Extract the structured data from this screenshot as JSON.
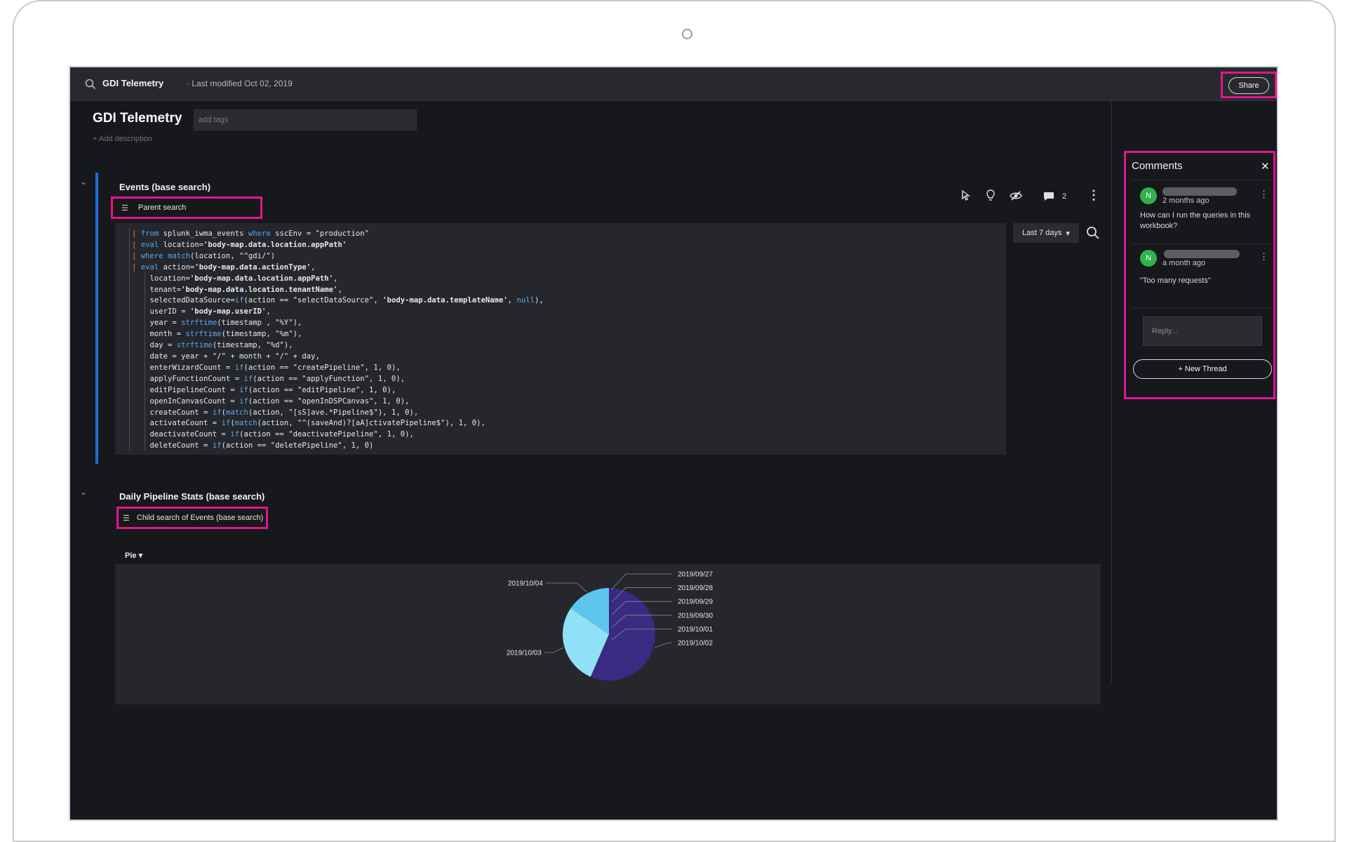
{
  "topbar": {
    "title": "GDI Telemetry",
    "modified": "· Last modified Oct 02, 2019",
    "share_label": "Share"
  },
  "header": {
    "title": "GDI Telemetry",
    "tags_placeholder": "add tags",
    "add_description": "+ Add description"
  },
  "events_section": {
    "title": "Events (base search)",
    "chip_label": "Parent search",
    "comment_count": "2",
    "time_range": "Last 7 days",
    "code_lines": [
      "| from splunk_iwma_events where sscEnv = \"production\"",
      "| eval location='body-map.data.location.appPath'",
      "| where match(location, \"^gdi/\")",
      "| eval action='body-map.data.actionType',",
      "    location='body-map.data.location.appPath',",
      "    tenant='body-map.data.location.tenantName',",
      "    selectedDataSource=if(action == \"selectDataSource\", 'body-map.data.templateName', null),",
      "    userID = 'body-map.userID',",
      "    year = strftime(timestamp , \"%Y\"),",
      "    month = strftime(timestamp, \"%m\"),",
      "    day = strftime(timestamp, \"%d\"),",
      "    date = year + \"/\" + month + \"/\" + day,",
      "    enterWizardCount = if(action == \"createPipeline\", 1, 0),",
      "    applyFunctionCount = if(action == \"applyFunction\", 1, 0),",
      "    editPipelineCount = if(action == \"editPipeline\", 1, 0),",
      "    openInCanvasCount = if(action == \"openInDSPCanvas\", 1, 0),",
      "    createCount = if(match(action, \"[sS]ave.*Pipeline$\"), 1, 0),",
      "    activateCount = if(match(action, \"^(saveAnd)?[aA]ctivatePipeline$\"), 1, 0),",
      "    deactivateCount = if(action == \"deactivatePipeline\", 1, 0),",
      "    deleteCount = if(action == \"deletePipeline\", 1, 0)"
    ]
  },
  "stats_section": {
    "title": "Daily Pipeline Stats (base search)",
    "chip_label": "Child search of Events (base search)",
    "viz_type": "Pie"
  },
  "chart_data": {
    "type": "pie",
    "categories": [
      "2019/09/27",
      "2019/09/28",
      "2019/09/29",
      "2019/09/30",
      "2019/10/01",
      "2019/10/02",
      "2019/10/03",
      "2019/10/04"
    ],
    "values": [
      0.5,
      0.5,
      0.5,
      0.5,
      0.5,
      54,
      28,
      15.5
    ],
    "colors": [
      "#3a2a80",
      "#3a2a80",
      "#3a2a80",
      "#3a2a80",
      "#3a2a80",
      "#3b2a82",
      "#8fe1f6",
      "#5cc6ee"
    ],
    "title": ""
  },
  "comments": {
    "title": "Comments",
    "items": [
      {
        "avatar": "N",
        "time": "2 months ago",
        "body": "How can I run the queries in this workbook?"
      },
      {
        "avatar": "N",
        "time": "a month ago",
        "body": "\"Too many requests\""
      }
    ],
    "reply_placeholder": "Reply...",
    "new_thread_label": "+ New Thread"
  }
}
